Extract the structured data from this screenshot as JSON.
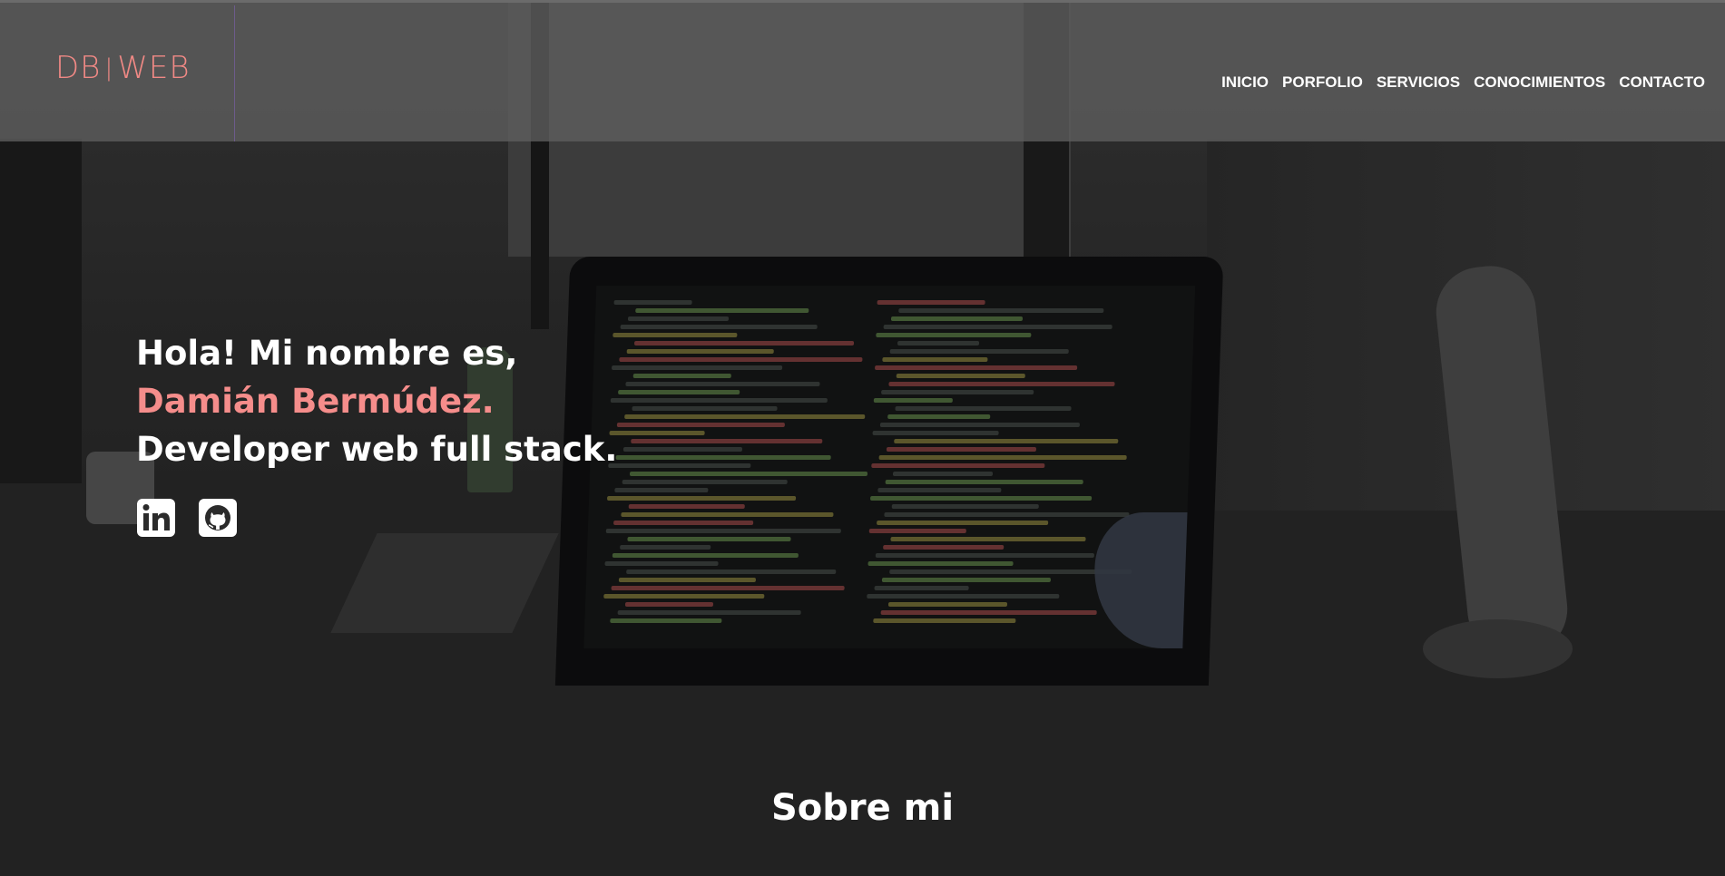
{
  "header": {
    "logo_left": "DB",
    "logo_sep": "|",
    "logo_right": "WEB"
  },
  "nav": {
    "items": [
      {
        "label": "INICIO"
      },
      {
        "label": "PORFOLIO"
      },
      {
        "label": "SERVICIOS"
      },
      {
        "label": "CONOCIMIENTOS"
      },
      {
        "label": "CONTACTO"
      }
    ]
  },
  "hero": {
    "greeting": "Hola! Mi nombre es,",
    "name": "Damián Bermúdez.",
    "role": "Developer web full stack."
  },
  "social": [
    {
      "icon": "linkedin-icon"
    },
    {
      "icon": "github-icon"
    }
  ],
  "about": {
    "title": "Sobre mi"
  },
  "colors": {
    "accent": "#f58d8b",
    "page_bg": "#222222",
    "header_bg": "#5f5f5f"
  }
}
